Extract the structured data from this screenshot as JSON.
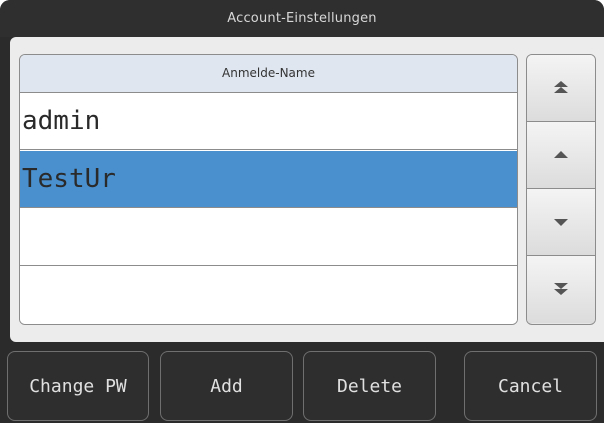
{
  "window": {
    "title": "Account-Einstellungen"
  },
  "list": {
    "header": "Anmelde-Name",
    "rows": [
      {
        "name": "admin",
        "selected": false
      },
      {
        "name": "TestUr",
        "selected": true
      },
      {
        "name": "",
        "selected": false
      },
      {
        "name": "",
        "selected": false
      }
    ]
  },
  "scroll": {
    "buttons": [
      {
        "icon": "double-up-arrow-icon"
      },
      {
        "icon": "up-arrow-icon"
      },
      {
        "icon": "down-arrow-icon"
      },
      {
        "icon": "double-down-arrow-icon"
      }
    ]
  },
  "actions": {
    "change_pw": "Change PW",
    "add": "Add",
    "delete": "Delete",
    "cancel": "Cancel"
  },
  "colors": {
    "selection": "#4a90cf",
    "window_bg": "#2b2b2b",
    "content_bg": "#ececec"
  }
}
